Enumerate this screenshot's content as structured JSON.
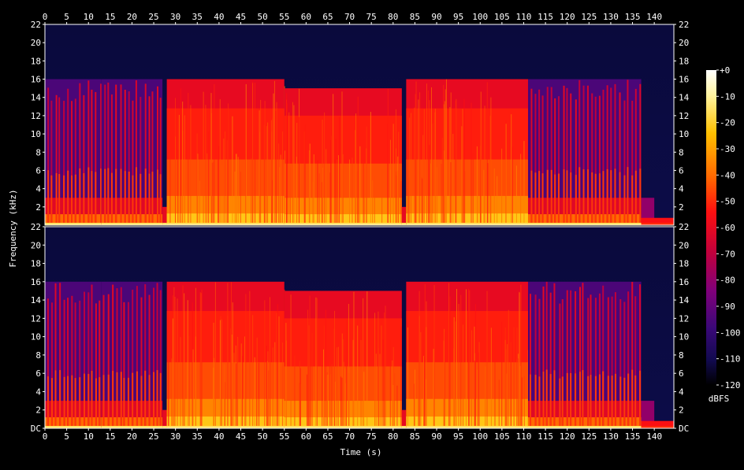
{
  "chart_data": {
    "type": "heatmap",
    "title": "",
    "xlabel": "Time (s)",
    "ylabel": "Frequency (kHz)",
    "xlim": [
      0,
      144.5
    ],
    "ylim": [
      0,
      22
    ],
    "x_ticks": [
      0,
      5,
      10,
      15,
      20,
      25,
      30,
      35,
      40,
      45,
      50,
      55,
      60,
      65,
      70,
      75,
      80,
      85,
      90,
      95,
      100,
      105,
      110,
      115,
      120,
      125,
      130,
      135,
      140
    ],
    "y_ticks_top": [
      "2",
      "4",
      "6",
      "8",
      "10",
      "12",
      "14",
      "16",
      "18",
      "20",
      "22"
    ],
    "y_ticks_bottom": [
      "DC",
      "2",
      "4",
      "6",
      "8",
      "10",
      "12",
      "14",
      "16",
      "18",
      "20",
      "22"
    ],
    "colorbar": {
      "label": "dBFS",
      "range": [
        -120,
        0
      ],
      "ticks": [
        "+0",
        "-10",
        "-20",
        "-30",
        "-40",
        "-50",
        "-60",
        "-70",
        "-80",
        "-90",
        "-100",
        "-110",
        "-120"
      ]
    },
    "channels": 2,
    "series": [
      {
        "values_description_segments": [
          {
            "start": 0,
            "end": 13,
            "cutoff_khz": 16,
            "level_dbfs": -70,
            "texture": "sparse-transients"
          },
          {
            "start": 13,
            "end": 27,
            "cutoff_khz": 16,
            "level_dbfs": -65,
            "texture": "sparse-transients"
          },
          {
            "start": 27,
            "end": 28,
            "cutoff_khz": 2,
            "level_dbfs": -100,
            "texture": "gap"
          },
          {
            "start": 28,
            "end": 55,
            "cutoff_khz": 16,
            "level_dbfs": -50,
            "texture": "dense"
          },
          {
            "start": 55,
            "end": 82,
            "cutoff_khz": 15,
            "level_dbfs": -52,
            "texture": "dense"
          },
          {
            "start": 82,
            "end": 83,
            "cutoff_khz": 2,
            "level_dbfs": -100,
            "texture": "gap"
          },
          {
            "start": 83,
            "end": 111,
            "cutoff_khz": 16,
            "level_dbfs": -50,
            "texture": "dense"
          },
          {
            "start": 111,
            "end": 137,
            "cutoff_khz": 16,
            "level_dbfs": -70,
            "texture": "sparse-transients"
          },
          {
            "start": 137,
            "end": 144.5,
            "cutoff_khz": 3,
            "level_dbfs": -100,
            "texture": "fade"
          }
        ]
      }
    ]
  }
}
